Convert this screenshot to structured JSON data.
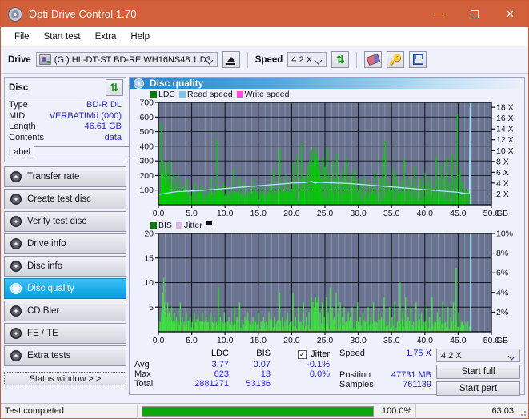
{
  "window": {
    "title": "Opti Drive Control 1.70",
    "icon": "disc-icon",
    "minimize": "─",
    "maximize": "☐",
    "close": "✕",
    "accent": "#d2603a"
  },
  "menu": {
    "items": [
      "File",
      "Start test",
      "Extra",
      "Help"
    ]
  },
  "toolbar": {
    "drive_label": "Drive",
    "drive_value": "(G:)  HL-DT-ST BD-RE  WH16NS48 1.D3",
    "eject_title": "Eject",
    "speed_label": "Speed",
    "speed_value": "4.2 X",
    "refresh_icon": "refresh-icon",
    "erase_icon": "eraser-icon",
    "keys_icon": "keys-icon",
    "save_icon": "floppy-save-icon"
  },
  "disc_panel": {
    "title": "Disc",
    "refresh_icon": "refresh-icon",
    "rows": [
      {
        "key": "Type",
        "value": "BD-R DL"
      },
      {
        "key": "MID",
        "value": "VERBATIMd (000)"
      },
      {
        "key": "Length",
        "value": "46.61 GB"
      },
      {
        "key": "Contents",
        "value": "data"
      }
    ],
    "label_key": "Label",
    "label_value": "",
    "label_placeholder": ""
  },
  "nav": {
    "items": [
      {
        "label": "Transfer rate",
        "active": false
      },
      {
        "label": "Create test disc",
        "active": false
      },
      {
        "label": "Verify test disc",
        "active": false
      },
      {
        "label": "Drive info",
        "active": false
      },
      {
        "label": "Disc info",
        "active": false
      },
      {
        "label": "Disc quality",
        "active": true
      },
      {
        "label": "CD Bler",
        "active": false
      },
      {
        "label": "FE / TE",
        "active": false
      },
      {
        "label": "Extra tests",
        "active": false
      }
    ],
    "status_window": "Status window > >"
  },
  "panel": {
    "title": "Disc quality",
    "icon": "disc-quality-icon"
  },
  "chart_data": [
    {
      "type": "bar",
      "name": "ldc-chart",
      "title": "",
      "xlabel": "GB",
      "ylabel": "",
      "legend": [
        {
          "label": "LDC",
          "color": "#008000"
        },
        {
          "label": "Read speed",
          "color": "#7ec8ef"
        },
        {
          "label": "Write speed",
          "color": "#ff4fd8"
        }
      ],
      "legend_position": "top-left",
      "grid": true,
      "plot_bg": "#6a7490",
      "x": {
        "ticks": [
          "0.0",
          "5.0",
          "10.0",
          "15.0",
          "20.0",
          "25.0",
          "30.0",
          "35.0",
          "40.0",
          "45.0",
          "50.0"
        ],
        "min": 0,
        "max": 50,
        "unit": "GB"
      },
      "y_left": {
        "ticks": [
          100,
          200,
          300,
          400,
          500,
          600,
          700
        ],
        "min": 0,
        "max": 700
      },
      "y_right": {
        "ticks": [
          "2 X",
          "4 X",
          "6 X",
          "8 X",
          "10 X",
          "12 X",
          "14 X",
          "16 X",
          "18 X"
        ],
        "min": 0,
        "max": 18.9
      },
      "series": [
        {
          "name": "LDC",
          "color": "#00cc00",
          "kind": "bars",
          "x": [
            0.2,
            0.35,
            0.5,
            0.6,
            0.7,
            0.85,
            1.0,
            1.15,
            1.3,
            1.45,
            1.6,
            1.8,
            2.0,
            2.2,
            2.4,
            2.6,
            2.8,
            3.0,
            3.2,
            3.45,
            3.7,
            3.9,
            4.2,
            4.5,
            4.8,
            5.1,
            5.4,
            5.7,
            6.0,
            6.3,
            6.6,
            6.9,
            7.2,
            7.5,
            7.8,
            8.1,
            8.4,
            8.7,
            8.9,
            9.1,
            9.4,
            9.7,
            10.0,
            10.3,
            10.6,
            10.9,
            11.2,
            11.5,
            11.8,
            12.1,
            12.4,
            12.7,
            13.0,
            13.3,
            13.6,
            13.9,
            14.2,
            14.5,
            14.8,
            15.1,
            15.4,
            15.7,
            16.0,
            16.3,
            16.6,
            16.9,
            17.2,
            17.5,
            17.8,
            18.1,
            18.4,
            18.7,
            19.0,
            19.3,
            19.6,
            19.9,
            20.2,
            20.5,
            20.8,
            21.1,
            21.4,
            21.7,
            22.0,
            22.3,
            22.6,
            22.9,
            23.1,
            23.3,
            23.5,
            23.7,
            23.9,
            24.1,
            24.3,
            24.6,
            24.9,
            25.2,
            25.5,
            25.8,
            26.1,
            26.4,
            26.7,
            27.0,
            27.3,
            27.6,
            27.9,
            28.2,
            28.5,
            28.8,
            29.1,
            29.4,
            29.7,
            30.0,
            30.4,
            30.8,
            31.2,
            31.6,
            32.0,
            32.4,
            32.8,
            33.2,
            33.6,
            34.0,
            34.4,
            34.8,
            35.2,
            35.6,
            36.0,
            36.4,
            36.8,
            37.2,
            37.6,
            38.0,
            38.4,
            38.8,
            39.2,
            39.6,
            40.0,
            40.4,
            40.8,
            41.2,
            41.6,
            42.0,
            42.4,
            42.8,
            43.2,
            43.6,
            44.0,
            44.4,
            44.8,
            45.2,
            45.6,
            46.0,
            46.4,
            46.7
          ],
          "values": [
            90,
            560,
            250,
            300,
            180,
            220,
            140,
            280,
            200,
            120,
            300,
            160,
            90,
            220,
            80,
            140,
            70,
            200,
            90,
            110,
            130,
            90,
            180,
            70,
            60,
            100,
            150,
            60,
            90,
            130,
            70,
            110,
            60,
            90,
            190,
            80,
            110,
            450,
            120,
            90,
            100,
            160,
            80,
            130,
            70,
            100,
            240,
            90,
            80,
            190,
            70,
            150,
            60,
            90,
            120,
            80,
            170,
            60,
            90,
            110,
            70,
            130,
            90,
            60,
            150,
            80,
            250,
            110,
            90,
            380,
            140,
            100,
            200,
            90,
            160,
            110,
            290,
            150,
            340,
            120,
            420,
            180,
            200,
            260,
            300,
            380,
            280,
            350,
            390,
            330,
            300,
            240,
            180,
            320,
            260,
            390,
            200,
            150,
            300,
            180,
            350,
            130,
            200,
            250,
            160,
            320,
            140,
            210,
            170,
            240,
            110,
            180,
            130,
            200,
            90,
            160,
            120,
            230,
            100,
            180,
            340,
            440,
            160,
            120,
            250,
            200,
            140,
            170,
            320,
            110,
            190,
            130,
            260,
            100,
            180,
            140,
            220,
            150,
            190,
            120,
            330,
            170,
            280,
            200,
            320,
            150,
            340,
            190,
            620,
            230,
            160,
            110
          ]
        },
        {
          "name": "Read speed",
          "color": "#aee6f8",
          "kind": "line",
          "x": [
            0.0,
            1.0,
            2.0,
            3.0,
            4.0,
            5.0,
            6.0,
            7.0,
            8.0,
            9.0,
            10.0,
            11.0,
            12.0,
            13.0,
            14.0,
            15.0,
            16.0,
            17.0,
            18.0,
            19.0,
            20.0,
            21.0,
            22.0,
            23.0,
            23.5,
            24.0,
            25.0,
            26.0,
            27.0,
            28.0,
            29.0,
            30.0,
            31.0,
            32.0,
            33.0,
            34.0,
            35.0,
            36.0,
            37.0,
            38.0,
            39.0,
            40.0,
            41.0,
            42.0,
            43.0,
            44.0,
            45.0,
            46.0,
            46.7,
            46.8
          ],
          "values_x": [
            1.9,
            2.1,
            2.3,
            2.45,
            2.5,
            2.55,
            2.6,
            2.7,
            2.8,
            2.9,
            3.0,
            3.1,
            3.2,
            3.3,
            3.4,
            3.5,
            3.6,
            3.7,
            3.8,
            3.9,
            4.0,
            4.05,
            4.1,
            4.3,
            4.0,
            4.15,
            4.1,
            4.05,
            4.0,
            3.95,
            3.9,
            3.8,
            3.7,
            3.6,
            3.5,
            3.4,
            3.3,
            3.2,
            3.1,
            3.0,
            2.9,
            2.8,
            2.7,
            2.6,
            2.5,
            2.4,
            2.3,
            2.1,
            2.05,
            18.0
          ]
        },
        {
          "name": "Write speed",
          "color": "#ff4fd8",
          "kind": "line",
          "x": [],
          "values": []
        }
      ]
    },
    {
      "type": "bar",
      "name": "bis-chart",
      "title": "",
      "xlabel": "GB",
      "ylabel": "",
      "legend": [
        {
          "label": "BIS",
          "color": "#008000"
        },
        {
          "label": "Jitter",
          "color": "#d8b8e0"
        }
      ],
      "legend_position": "top-left",
      "grid": true,
      "plot_bg": "#6a7490",
      "x": {
        "ticks": [
          "0.0",
          "5.0",
          "10.0",
          "15.0",
          "20.0",
          "25.0",
          "30.0",
          "35.0",
          "40.0",
          "45.0",
          "50.0"
        ],
        "min": 0,
        "max": 50,
        "unit": "GB"
      },
      "y_left": {
        "ticks": [
          5,
          10,
          15,
          20
        ],
        "min": 0,
        "max": 20
      },
      "y_right": {
        "ticks": [
          "2%",
          "4%",
          "6%",
          "8%",
          "10%"
        ],
        "min": 0,
        "max": 10
      },
      "series": [
        {
          "name": "BIS",
          "color": "#3de03d",
          "kind": "bars",
          "x": [
            0.2,
            0.4,
            0.6,
            0.7,
            0.8,
            0.9,
            1.1,
            1.3,
            1.5,
            1.7,
            1.9,
            2.1,
            2.3,
            2.6,
            2.9,
            3.2,
            3.5,
            3.8,
            4.1,
            4.4,
            4.7,
            5.0,
            5.3,
            5.6,
            5.9,
            6.2,
            6.5,
            6.8,
            7.1,
            7.4,
            7.7,
            8.0,
            8.3,
            8.6,
            8.9,
            9.2,
            9.5,
            9.8,
            10.1,
            10.5,
            10.9,
            11.3,
            11.7,
            12.1,
            12.5,
            12.9,
            13.3,
            13.7,
            14.1,
            14.5,
            14.9,
            15.3,
            15.7,
            16.1,
            16.5,
            16.9,
            17.3,
            17.7,
            18.1,
            18.5,
            18.9,
            19.3,
            19.7,
            20.1,
            20.5,
            20.9,
            21.3,
            21.7,
            22.1,
            22.5,
            22.9,
            23.1,
            23.3,
            23.5,
            23.7,
            23.9,
            24.2,
            24.5,
            24.8,
            25.1,
            25.4,
            25.7,
            26.0,
            26.3,
            26.6,
            26.9,
            27.2,
            27.5,
            27.8,
            28.1,
            28.4,
            28.7,
            29.0,
            29.4,
            29.8,
            30.2,
            30.6,
            31.0,
            31.4,
            31.8,
            32.2,
            32.6,
            33.0,
            33.4,
            33.8,
            34.2,
            34.6,
            35.0,
            35.4,
            35.8,
            36.2,
            36.6,
            37.0,
            37.4,
            37.8,
            38.2,
            38.6,
            39.0,
            39.4,
            39.8,
            40.2,
            40.6,
            41.0,
            41.4,
            41.8,
            42.2,
            42.6,
            43.0,
            43.4,
            43.8,
            44.2,
            44.6,
            45.0,
            45.4,
            45.8,
            46.2,
            46.5
          ],
          "values": [
            2,
            4,
            8,
            11,
            6,
            5,
            3,
            6,
            4,
            3,
            5,
            2,
            4,
            3,
            2,
            6,
            3,
            2,
            4,
            2,
            3,
            2,
            4,
            2,
            3,
            2,
            4,
            2,
            3,
            2,
            4,
            2,
            3,
            2,
            9,
            3,
            2,
            4,
            2,
            3,
            2,
            5,
            3,
            6,
            2,
            3,
            4,
            2,
            3,
            2,
            4,
            2,
            3,
            2,
            4,
            2,
            3,
            2,
            8,
            3,
            2,
            4,
            2,
            8,
            3,
            5,
            2,
            6,
            3,
            4,
            7,
            6,
            5,
            7,
            6,
            7,
            4,
            6,
            3,
            7,
            4,
            9,
            5,
            3,
            8,
            4,
            6,
            3,
            5,
            2,
            4,
            3,
            5,
            2,
            6,
            3,
            4,
            2,
            5,
            3,
            6,
            2,
            4,
            3,
            7,
            2,
            5,
            3,
            6,
            2,
            10,
            4,
            7,
            3,
            5,
            2,
            6,
            3,
            4,
            2,
            5,
            3,
            7,
            2,
            4,
            3,
            6,
            2,
            5,
            3,
            6,
            13,
            4,
            2
          ]
        },
        {
          "name": "Jitter",
          "color": "#d8b8e0",
          "kind": "line",
          "x": [],
          "values": []
        }
      ]
    }
  ],
  "stats": {
    "col_headers": [
      "LDC",
      "BIS"
    ],
    "rows": [
      {
        "label": "Avg",
        "ldc": "3.77",
        "bis": "0.07",
        "jitter": "-0.1%"
      },
      {
        "label": "Max",
        "ldc": "623",
        "bis": "13",
        "jitter": "0.0%"
      },
      {
        "label": "Total",
        "ldc": "2881271",
        "bis": "53136",
        "jitter": ""
      }
    ],
    "jitter_label": "Jitter",
    "jitter_checked": true,
    "info": [
      {
        "label": "Speed",
        "value": "1.75 X"
      },
      {
        "label": "Position",
        "value": "47731 MB"
      },
      {
        "label": "Samples",
        "value": "761139"
      }
    ],
    "speed_select": "4.2 X",
    "start_full": "Start full",
    "start_part": "Start part"
  },
  "statusbar": {
    "message": "Test completed",
    "progress_percent": 100,
    "progress_text": "100.0%",
    "elapsed": "63:03",
    "progress_color": "#0aa80a"
  }
}
